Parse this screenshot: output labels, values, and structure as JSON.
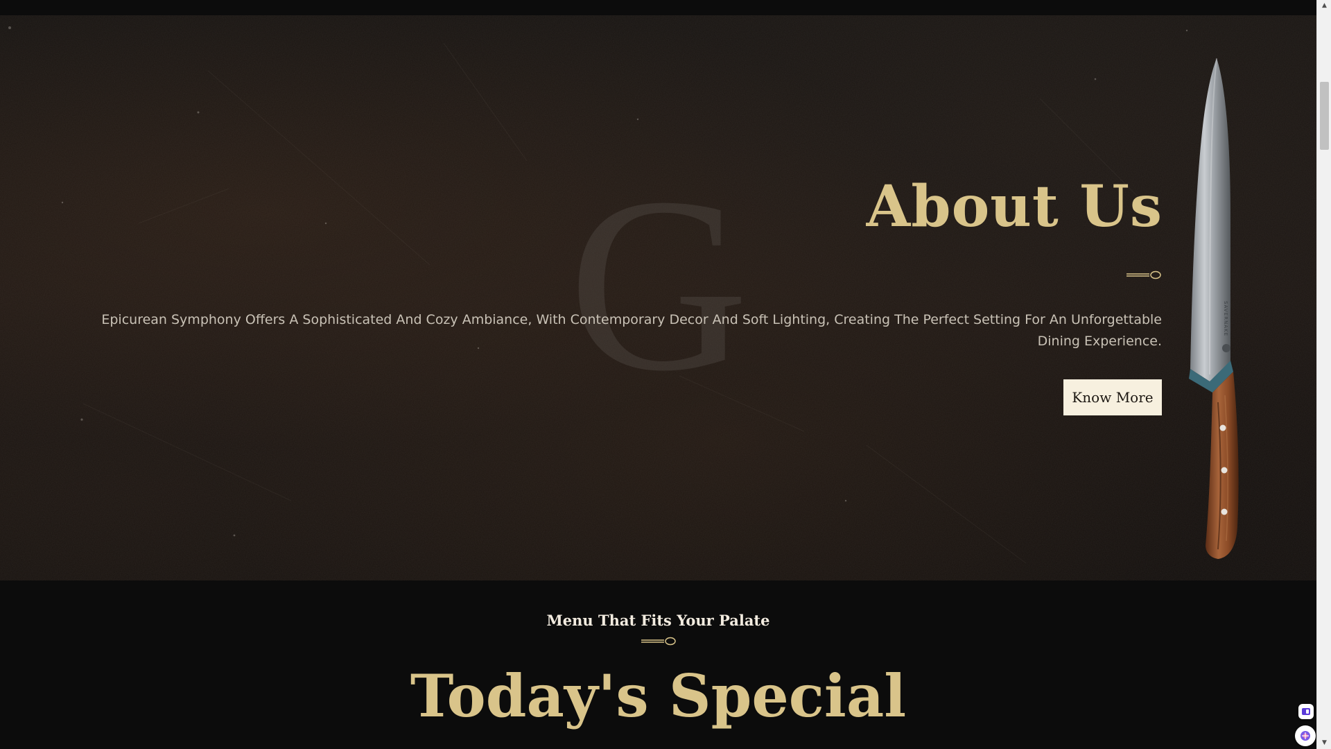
{
  "about": {
    "watermark_letter": "G",
    "title": "About Us",
    "description": "Epicurean Symphony Offers A Sophisticated And Cozy Ambiance, With Contemporary Decor And Soft Lighting, Creating The Perfect Setting For An Unforgettable Dining Experience.",
    "button_label": "Know More",
    "knife_brand": "SAVERNAKE"
  },
  "menu": {
    "subtitle": "Menu That Fits Your Palate",
    "title": "Today's Special"
  },
  "icons": {
    "divider": "cutlery-divider-icon",
    "knife": "chef-knife-image",
    "widget_top": "extension-icon",
    "widget_bottom": "assistant-icon"
  },
  "colors": {
    "gold": "#d9c48a",
    "cream": "#f7f0df",
    "background": "#0c0c0c",
    "body_text": "#c9c2b6"
  }
}
